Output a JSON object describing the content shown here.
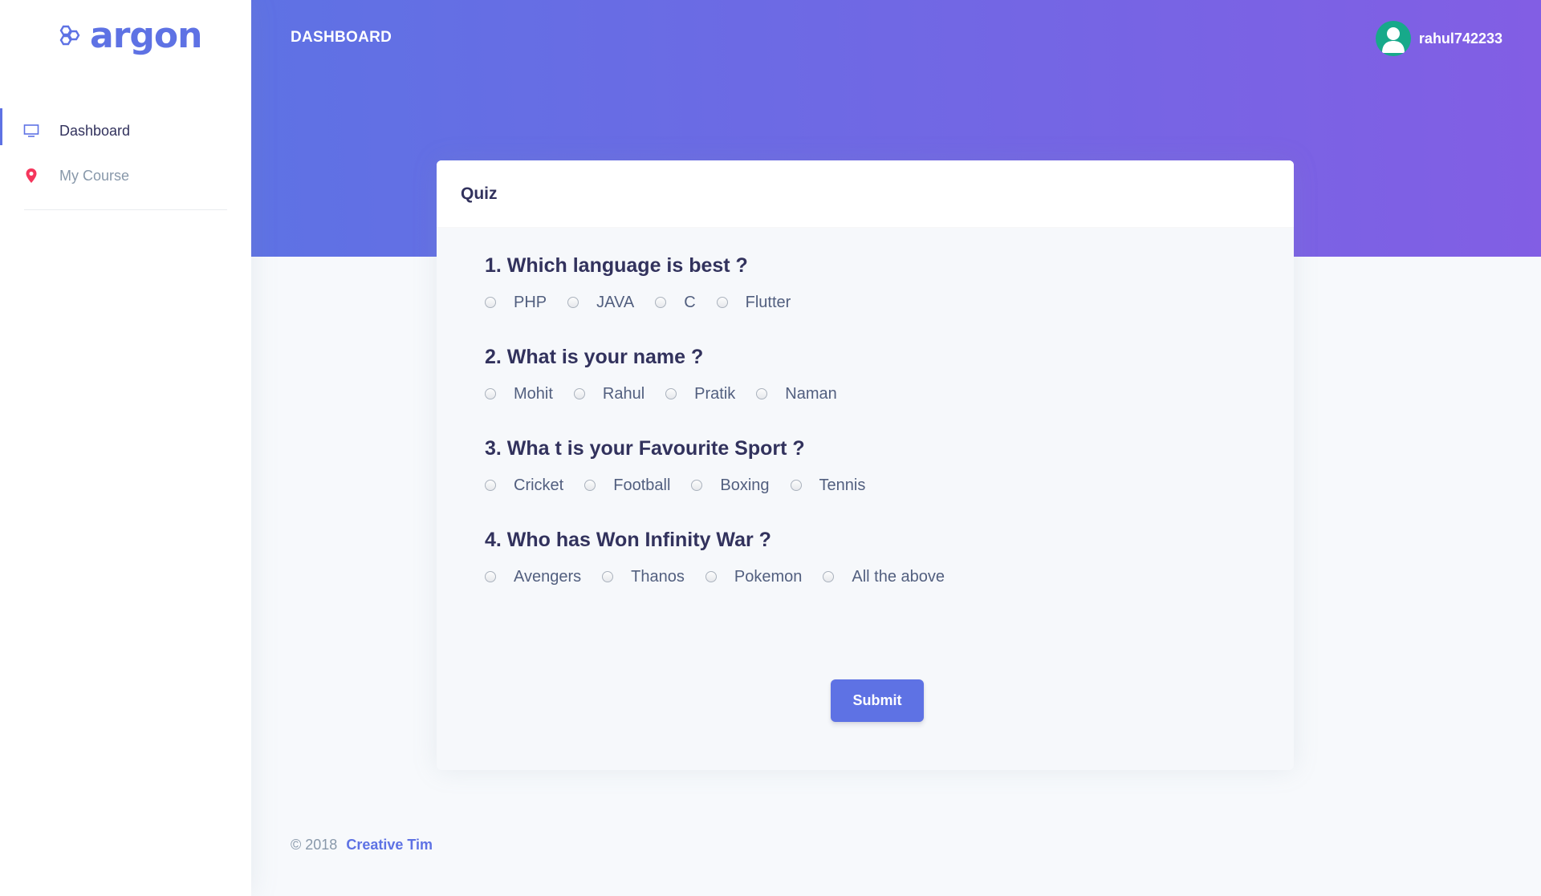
{
  "brand": {
    "name": "argon",
    "icon": "hexagons-logo-icon"
  },
  "sidebar": {
    "items": [
      {
        "label": "Dashboard",
        "icon": "monitor-icon",
        "active": true
      },
      {
        "label": "My Course",
        "icon": "map-pin-icon",
        "active": false
      }
    ]
  },
  "header": {
    "title": "DASHBOARD",
    "user": {
      "name": "rahul742233",
      "avatar_icon": "user-avatar-icon"
    }
  },
  "card": {
    "title": "Quiz",
    "questions": [
      {
        "text": "1. Which language is best ?",
        "options": [
          "PHP",
          "JAVA",
          "C",
          "Flutter"
        ]
      },
      {
        "text": "2. What is your name ?",
        "options": [
          "Mohit",
          "Rahul",
          "Pratik",
          "Naman"
        ]
      },
      {
        "text": "3. Wha t is your Favourite Sport ?",
        "options": [
          "Cricket",
          "Football",
          "Boxing",
          "Tennis"
        ]
      },
      {
        "text": "4. Who has Won Infinity War ?",
        "options": [
          "Avengers",
          "Thanos",
          "Pokemon",
          "All the above"
        ]
      }
    ],
    "submit_label": "Submit"
  },
  "footer": {
    "copyright": "© 2018",
    "link_text": "Creative Tim"
  },
  "colors": {
    "primary": "#5e72e4",
    "gradient_end": "#825ee4",
    "pin": "#f5365c",
    "avatar": "#17a98a"
  }
}
